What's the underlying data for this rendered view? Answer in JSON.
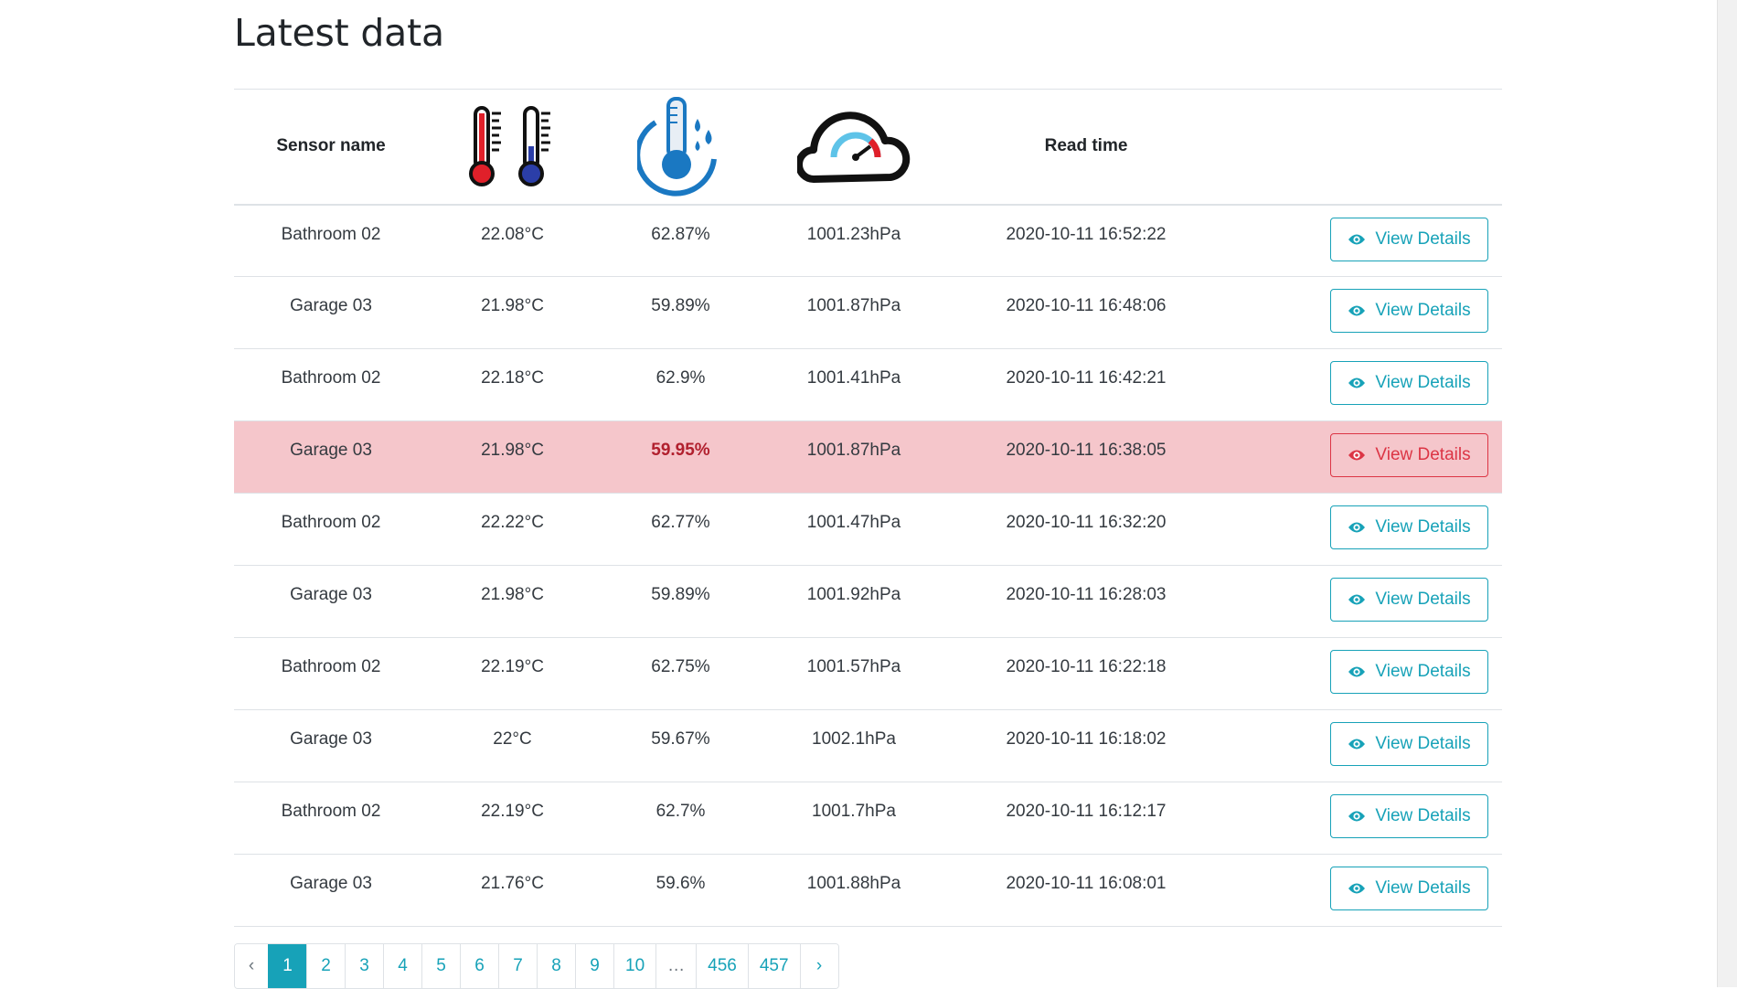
{
  "page": {
    "title": "Latest data"
  },
  "table": {
    "headers": {
      "sensor_name": "Sensor name",
      "temperature_icon": "thermometers-icon",
      "humidity_icon": "humidity-thermometer-icon",
      "pressure_icon": "pressure-gauge-cloud-icon",
      "read_time": "Read time"
    },
    "rows": [
      {
        "sensor": "Bathroom 02",
        "temperature": "22.08°C",
        "humidity": "62.87%",
        "pressure": "1001.23hPa",
        "read_time": "2020-10-11 16:52:22",
        "action": "View Details",
        "highlight": false
      },
      {
        "sensor": "Garage 03",
        "temperature": "21.98°C",
        "humidity": "59.89%",
        "pressure": "1001.87hPa",
        "read_time": "2020-10-11 16:48:06",
        "action": "View Details",
        "highlight": false
      },
      {
        "sensor": "Bathroom 02",
        "temperature": "22.18°C",
        "humidity": "62.9%",
        "pressure": "1001.41hPa",
        "read_time": "2020-10-11 16:42:21",
        "action": "View Details",
        "highlight": false
      },
      {
        "sensor": "Garage 03",
        "temperature": "21.98°C",
        "humidity": "59.95%",
        "pressure": "1001.87hPa",
        "read_time": "2020-10-11 16:38:05",
        "action": "View Details",
        "highlight": true
      },
      {
        "sensor": "Bathroom 02",
        "temperature": "22.22°C",
        "humidity": "62.77%",
        "pressure": "1001.47hPa",
        "read_time": "2020-10-11 16:32:20",
        "action": "View Details",
        "highlight": false
      },
      {
        "sensor": "Garage 03",
        "temperature": "21.98°C",
        "humidity": "59.89%",
        "pressure": "1001.92hPa",
        "read_time": "2020-10-11 16:28:03",
        "action": "View Details",
        "highlight": false
      },
      {
        "sensor": "Bathroom 02",
        "temperature": "22.19°C",
        "humidity": "62.75%",
        "pressure": "1001.57hPa",
        "read_time": "2020-10-11 16:22:18",
        "action": "View Details",
        "highlight": false
      },
      {
        "sensor": "Garage 03",
        "temperature": "22°C",
        "humidity": "59.67%",
        "pressure": "1002.1hPa",
        "read_time": "2020-10-11 16:18:02",
        "action": "View Details",
        "highlight": false
      },
      {
        "sensor": "Bathroom 02",
        "temperature": "22.19°C",
        "humidity": "62.7%",
        "pressure": "1001.7hPa",
        "read_time": "2020-10-11 16:12:17",
        "action": "View Details",
        "highlight": false
      },
      {
        "sensor": "Garage 03",
        "temperature": "21.76°C",
        "humidity": "59.6%",
        "pressure": "1001.88hPa",
        "read_time": "2020-10-11 16:08:01",
        "action": "View Details",
        "highlight": false
      }
    ]
  },
  "pagination": {
    "prev": "‹",
    "pages": [
      "1",
      "2",
      "3",
      "4",
      "5",
      "6",
      "7",
      "8",
      "9",
      "10",
      "…",
      "456",
      "457"
    ],
    "active": "1",
    "next": "›"
  },
  "colors": {
    "accent": "#17a2b8",
    "danger": "#dc3545",
    "danger_row": "#f5c6cb",
    "alert_text": "#b1202e"
  }
}
